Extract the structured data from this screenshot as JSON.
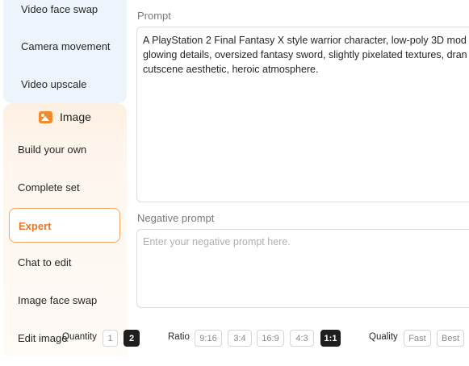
{
  "sidebar": {
    "items_top": [
      "Video face swap",
      "Camera movement",
      "Video upscale"
    ],
    "section": {
      "label": "Image",
      "icon": "image-icon"
    },
    "items_bottom": [
      "Build your own",
      "Complete set",
      "Expert",
      "Chat to edit",
      "Image face swap",
      "Edit image"
    ],
    "active_item": "Expert"
  },
  "prompt": {
    "label": "Prompt",
    "lines": [
      "A PlayStation 2 Final Fantasy X style warrior character, low-poly 3D mod",
      "glowing details, oversized fantasy sword, slightly pixelated textures, dran",
      "cutscene aesthetic, heroic atmosphere."
    ]
  },
  "negative_prompt": {
    "label": "Negative prompt",
    "value": "",
    "placeholder": "Enter your negative prompt here."
  },
  "options": {
    "quantity": {
      "label": "Quantity",
      "options": [
        "1",
        "2"
      ],
      "selected": "2"
    },
    "ratio": {
      "label": "Ratio",
      "options": [
        "9:16",
        "3:4",
        "16:9",
        "4:3",
        "1:1"
      ],
      "selected": "1:1"
    },
    "quality": {
      "label": "Quality",
      "options": [
        "Fast",
        "Best"
      ],
      "selected": ""
    }
  },
  "colors": {
    "accent": "#e8772a",
    "active_border": "#f0a868",
    "selected_button": "#1f1f1f"
  }
}
